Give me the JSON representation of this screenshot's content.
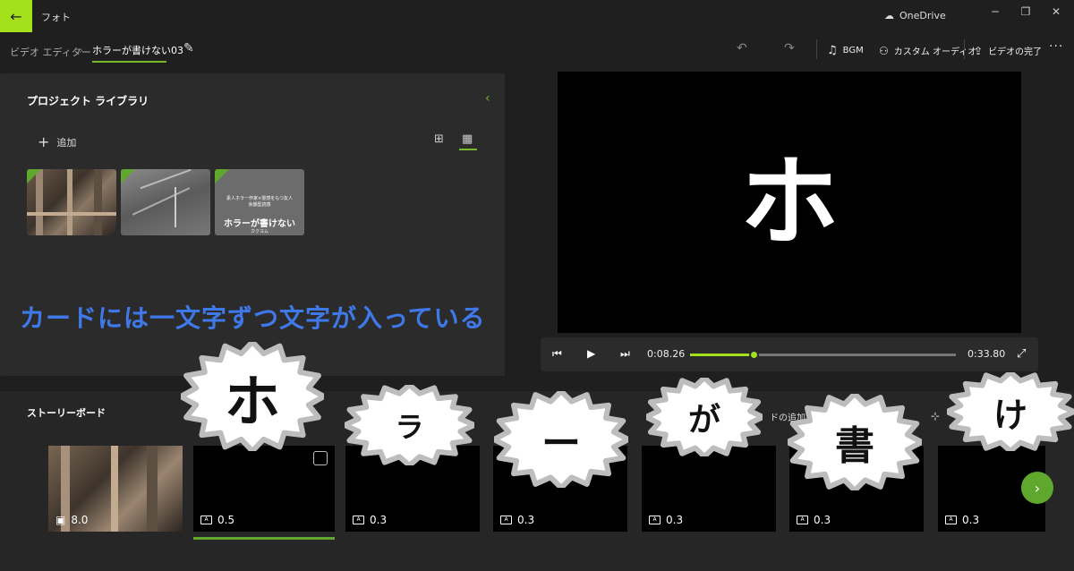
{
  "titlebar": {
    "back_icon": "arrow-left-icon",
    "app_title": "フォト",
    "onedrive_label": "OneDrive",
    "minimize": "─",
    "restore": "❐",
    "close": "✕"
  },
  "toolbar": {
    "crumb_root": "ビデオ エディター",
    "crumb_sep": "›",
    "crumb_project": "ホラーが書けない03",
    "undo_icon": "↶",
    "redo_icon": "↷",
    "bgm_label": "BGM",
    "custom_audio_label": "カスタム オーディオ",
    "finish_label": "ビデオの完了",
    "more": "···"
  },
  "library": {
    "title": "プロジェクト ライブラリ",
    "collapse": "‹",
    "add_label": "追加",
    "add_plus": "+",
    "view_large": "⊞",
    "view_small": "▦",
    "title_card": {
      "small_line1": "素人ホラー作家×霊感をもつ友人",
      "small_line2": "余韻型読感",
      "big": "ホラーが書けない",
      "sub": "カクヨム"
    }
  },
  "preview": {
    "char": "ホ"
  },
  "player": {
    "prev_icon": "⏮",
    "play_icon": "▶",
    "next_icon": "⏭",
    "current_time": "0:08.26",
    "total_time": "0:33.80",
    "progress": 0.244,
    "fullscreen_icon": "⤢"
  },
  "caption": "カードには一文字ずつ文字が入っている",
  "storyboard": {
    "title": "ストーリーボード",
    "partial_label": "ドの追加",
    "partial_icon": "⊹",
    "cards": [
      {
        "duration": "8.0",
        "icon": "image-icon"
      },
      {
        "duration": "0.5",
        "icon": "title-card-icon"
      },
      {
        "duration": "0.3",
        "icon": "title-card-icon"
      },
      {
        "duration": "0.3",
        "icon": "title-card-icon"
      },
      {
        "duration": "0.3",
        "icon": "title-card-icon"
      },
      {
        "duration": "0.3",
        "icon": "title-card-icon"
      },
      {
        "duration": "0.3",
        "icon": "title-card-icon"
      }
    ],
    "next_icon": "›"
  },
  "bursts": [
    "ホ",
    "ラ",
    "ー",
    "が",
    "書",
    "け"
  ],
  "colors": {
    "accent": "#a4e01c",
    "accent_dark": "#5fa82d",
    "caption": "#3f78e8",
    "background": "#1f1f1f",
    "panel": "#2b2b2b"
  }
}
